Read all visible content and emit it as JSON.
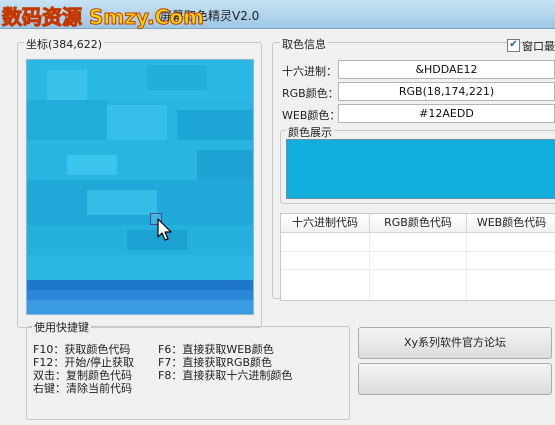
{
  "window": {
    "watermark": "数码资源 Smzy.Com",
    "title_visible": "屏幕取色精灵V2.0"
  },
  "coords": {
    "label": "坐标(384,622)"
  },
  "color_info": {
    "group_label": "取色信息",
    "hex_label": "十六进制：",
    "hex_value": "&HDDAE12",
    "rgb_label": "RGB颜色：",
    "rgb_value": "RGB(18,174,221)",
    "web_label": "WEB颜色：",
    "web_value": "#12AEDD",
    "always_on_top_label": "窗口最",
    "always_on_top_checked": true,
    "preview_label": "颜色展示",
    "preview_color": "#12AEDD"
  },
  "history_table": {
    "columns": [
      "十六进制代码",
      "RGB颜色代码",
      "WEB颜色代码"
    ],
    "rows": []
  },
  "hotkeys": {
    "group_label": "使用快捷键",
    "left": [
      "F10：获取颜色代码",
      "F12：开始/停止获取",
      "双击：复制颜色代码",
      "右键：清除当前代码"
    ],
    "right": [
      "F6：直接获取WEB颜色",
      "F7：直接获取RGB颜色",
      "F8：直接获取十六进制颜色"
    ]
  },
  "buttons": {
    "forum": "Xy系列软件官方论坛",
    "second": ""
  },
  "icons": {
    "cursor": "arrow-cursor-icon",
    "check": "checkmark-icon"
  }
}
